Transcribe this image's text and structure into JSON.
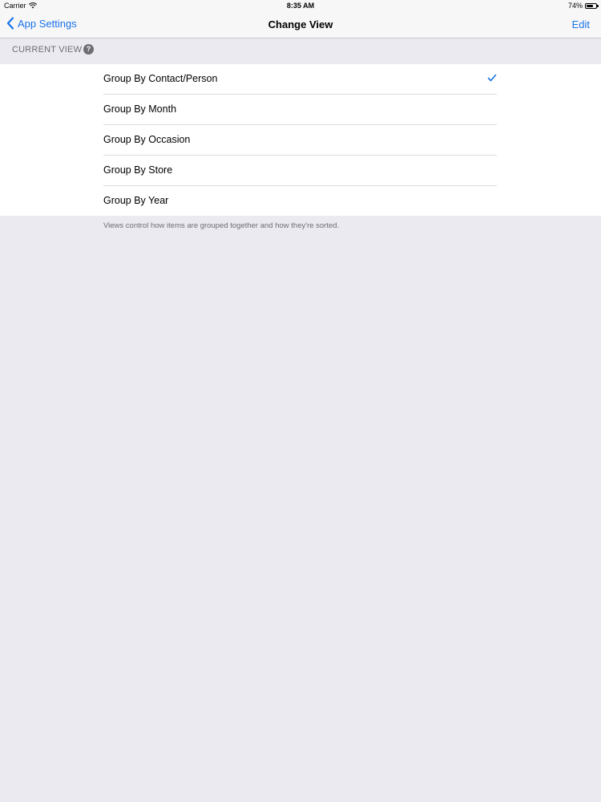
{
  "status_bar": {
    "carrier": "Carrier",
    "time": "8:35 AM",
    "battery_percent_label": "74%",
    "battery_level": 0.74
  },
  "nav": {
    "back_label": "App Settings",
    "title": "Change View",
    "edit_label": "Edit"
  },
  "section": {
    "header": "CURRENT VIEW",
    "help_glyph": "?"
  },
  "options": [
    {
      "label": "Group By Contact/Person",
      "selected": true
    },
    {
      "label": "Group By Month",
      "selected": false
    },
    {
      "label": "Group By Occasion",
      "selected": false
    },
    {
      "label": "Group By Store",
      "selected": false
    },
    {
      "label": "Group By Year",
      "selected": false
    }
  ],
  "footer_note": "Views control how items are grouped together and how they're sorted.",
  "colors": {
    "accent": "#1a73e8",
    "background": "#ebeaf0",
    "separator": "#dcdce0"
  },
  "icons": {
    "back": "chevron-left-icon",
    "help": "question-circle-icon",
    "check": "checkmark-icon",
    "wifi": "wifi-icon",
    "battery": "battery-icon"
  }
}
